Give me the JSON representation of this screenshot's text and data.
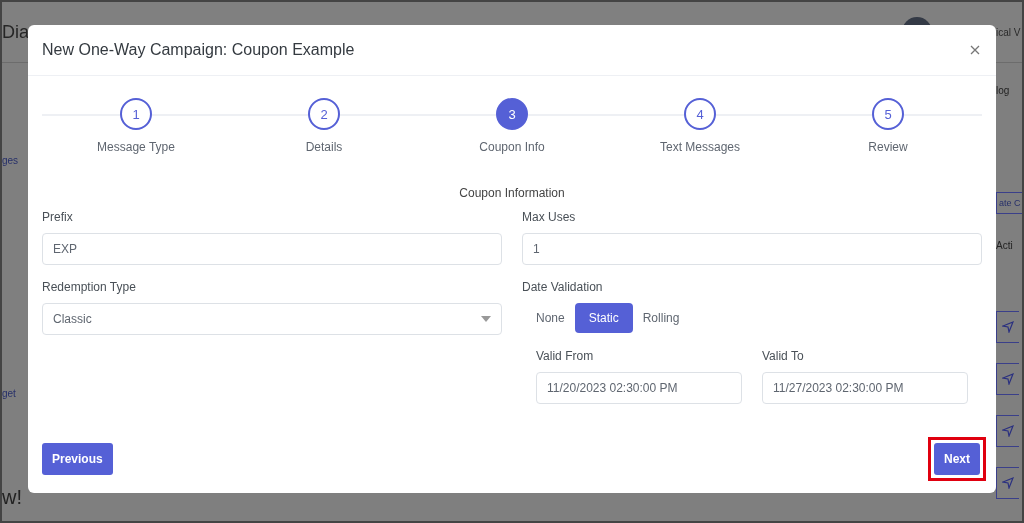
{
  "background": {
    "header_title": "Dia",
    "user_name": "ical V",
    "sidebar_links": [
      "ges",
      "get"
    ],
    "footer_text": "w!",
    "right_tab": "log",
    "right_button": "ate C",
    "right_column_header": "Acti"
  },
  "modal": {
    "title": "New One-Way Campaign: Coupon Example",
    "steps": [
      {
        "number": "1",
        "label": "Message Type",
        "selected": false
      },
      {
        "number": "2",
        "label": "Details",
        "selected": false
      },
      {
        "number": "3",
        "label": "Coupon Info",
        "selected": true
      },
      {
        "number": "4",
        "label": "Text Messages",
        "selected": false
      },
      {
        "number": "5",
        "label": "Review",
        "selected": false
      }
    ],
    "section_title": "Coupon Information",
    "prefix": {
      "label": "Prefix",
      "value": "EXP"
    },
    "max_uses": {
      "label": "Max Uses",
      "value": "1"
    },
    "redemption_type": {
      "label": "Redemption Type",
      "value": "Classic"
    },
    "date_validation": {
      "label": "Date Validation",
      "options": [
        {
          "label": "None",
          "selected": false
        },
        {
          "label": "Static",
          "selected": true
        },
        {
          "label": "Rolling",
          "selected": false
        }
      ]
    },
    "valid_from": {
      "label": "Valid From",
      "value": "11/20/2023 02:30:00 PM"
    },
    "valid_to": {
      "label": "Valid To",
      "value": "11/27/2023 02:30:00 PM"
    },
    "previous_button": "Previous",
    "next_button": "Next"
  }
}
